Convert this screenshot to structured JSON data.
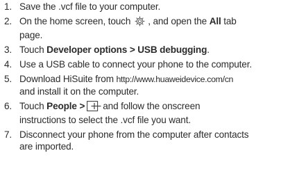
{
  "steps": [
    {
      "number": "1.",
      "text": "Save the .vcf file to your computer."
    },
    {
      "number": "2.",
      "part1": "On the home screen, touch",
      "icon1": "gear-icon",
      "part2": ", and open the",
      "bold1": "All",
      "part3": "tab",
      "line2": "page."
    },
    {
      "number": "3.",
      "part1": "Touch",
      "bold1": "Developer options > USB debugging",
      "part2": "."
    },
    {
      "number": "4.",
      "text": "Use a USB cable to connect your phone to the computer."
    },
    {
      "number": "5.",
      "part1": "Download HiSuite from",
      "url": "http://www.huaweidevice.com/cn",
      "line2": "and install it on the computer."
    },
    {
      "number": "6.",
      "part1": "Touch",
      "bold1": "People >",
      "icon1": "add-contact-icon",
      "part2": "and follow the onscreen",
      "line2": "instructions to select the .vcf file you want."
    },
    {
      "number": "7.",
      "text": "Disconnect your phone from the computer after contacts",
      "line2": "are imported."
    }
  ]
}
